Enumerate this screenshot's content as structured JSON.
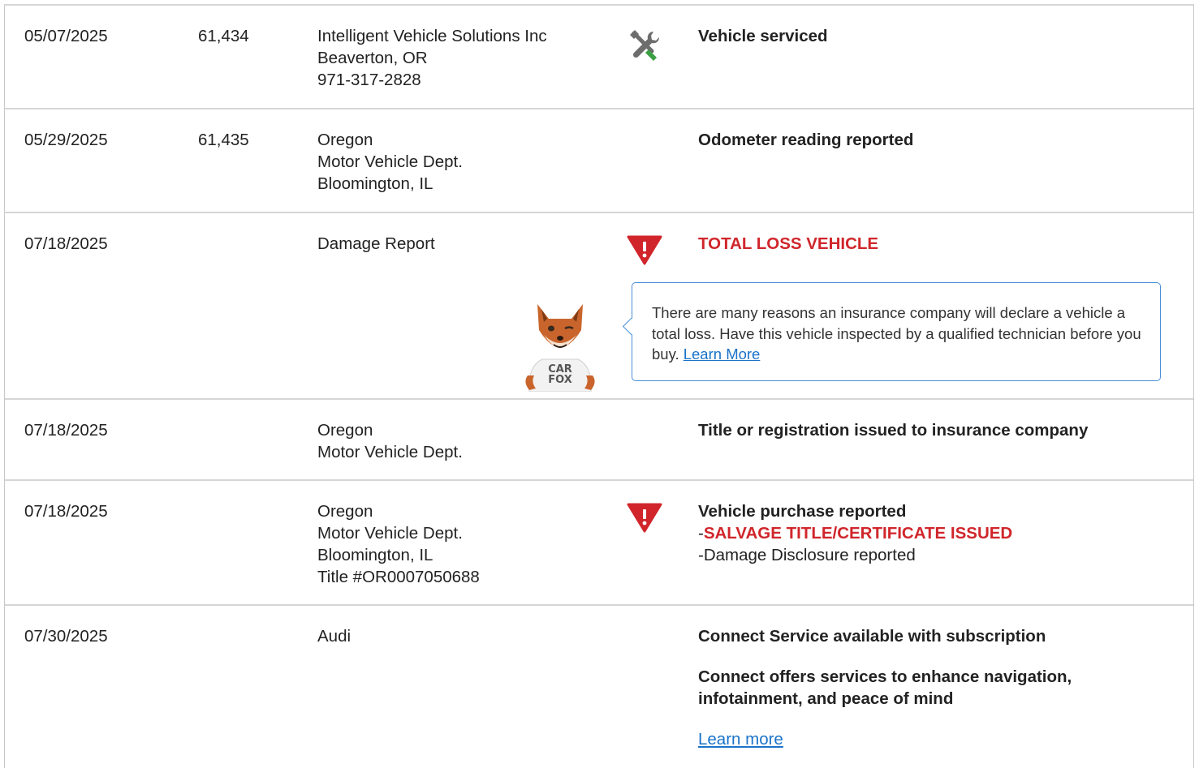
{
  "rows": [
    {
      "date": "05/07/2025",
      "odometer": "61,434",
      "source": [
        "Intelligent Vehicle Solutions Inc",
        "Beaverton, OR",
        "971-317-2828"
      ],
      "icon": "wrench-screwdriver-icon",
      "comment": "Vehicle serviced"
    },
    {
      "date": "05/29/2025",
      "odometer": "61,435",
      "source": [
        "Oregon",
        "Motor Vehicle Dept.",
        "Bloomington, IL"
      ],
      "comment": "Odometer reading reported"
    },
    {
      "date": "07/18/2025",
      "odometer": "",
      "source": [
        "Damage Report"
      ],
      "icon": "alert-triangle-icon",
      "comment": "TOTAL LOSS VEHICLE",
      "tooltip": {
        "text": "There are many reasons an insurance company will declare a vehicle a total loss. Have this vehicle inspected by a qualified technician before you buy.",
        "link": "Learn More",
        "mascot_label_1": "CAR",
        "mascot_label_2": "FOX"
      }
    },
    {
      "date": "07/18/2025",
      "odometer": "",
      "source": [
        "Oregon",
        "Motor Vehicle Dept."
      ],
      "comment": "Title or registration issued to insurance company"
    },
    {
      "date": "07/18/2025",
      "odometer": "",
      "source": [
        "Oregon",
        "Motor Vehicle Dept.",
        "Bloomington, IL",
        "Title #OR0007050688"
      ],
      "icon": "alert-triangle-icon",
      "comment": "Vehicle purchase reported",
      "sub_red": "SALVAGE TITLE/CERTIFICATE ISSUED",
      "sub_plain": "Damage Disclosure reported",
      "bullet": "-"
    },
    {
      "date": "07/30/2025",
      "odometer": "",
      "source": [
        "Audi"
      ],
      "comment": "Connect Service available with subscription",
      "comment2": [
        "Connect offers services to enhance navigation,",
        "infotainment, and peace of mind"
      ],
      "link": "Learn more"
    }
  ],
  "colors": {
    "alert_red": "#d0262b",
    "link_blue": "#1a73c9",
    "tooltip_border": "#4a8fd8"
  }
}
